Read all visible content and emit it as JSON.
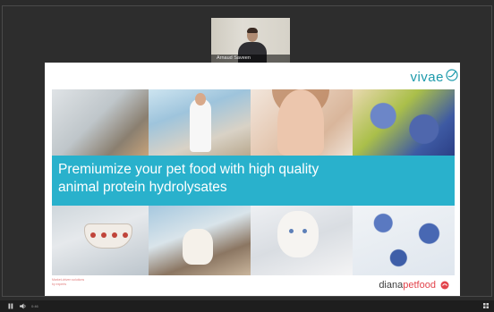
{
  "participant": {
    "name": "Arnaud Saveen"
  },
  "slide": {
    "logo_text": "vivae",
    "banner_line1": "Premiumize your pet food with high quality",
    "banner_line2": "animal protein hydrolysates",
    "footer_left": "Market-driven solutions by experts",
    "footer_brand_a": "diana",
    "footer_brand_b": "petfood"
  },
  "controls": {
    "time": "0:46"
  },
  "colors": {
    "accent": "#29b1cc",
    "brand_red": "#e2434b",
    "logo": "#1c9aab"
  }
}
